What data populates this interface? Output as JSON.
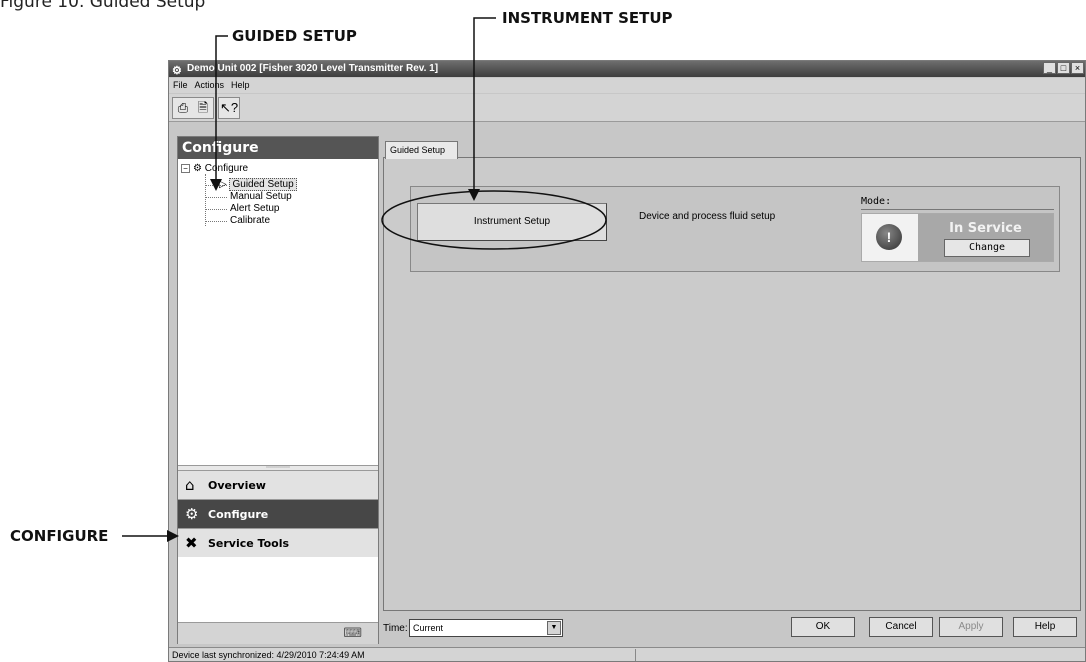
{
  "figure": {
    "title": "Figure 10. Guided Setup",
    "callouts": {
      "guided_setup": "GUIDED SETUP",
      "instrument_setup": "INSTRUMENT SETUP",
      "configure": "CONFIGURE"
    }
  },
  "window": {
    "title": "Demo Unit 002 [Fisher 3020 Level Transmitter Rev. 1]",
    "controls": [
      "_",
      "□",
      "×"
    ]
  },
  "menu": [
    "File",
    "Actions",
    "Help"
  ],
  "toolbar": {
    "icons": [
      "print-icon",
      "print-preview-icon",
      "help-pointer-icon"
    ]
  },
  "left_panel": {
    "header": "Configure",
    "tree": {
      "root": "Configure",
      "children": [
        "Guided Setup",
        "Manual Setup",
        "Alert Setup",
        "Calibrate"
      ],
      "selected": "Guided Setup"
    },
    "nav": [
      "Overview",
      "Configure",
      "Service Tools"
    ],
    "active_nav": "Configure"
  },
  "main": {
    "tab": "Guided Setup",
    "instrument_button": "Instrument Setup",
    "instrument_desc": "Device and process fluid setup",
    "mode": {
      "label": "Mode:",
      "status": "In Service",
      "change": "Change"
    }
  },
  "bottom": {
    "time_label": "Time:",
    "time_value": "Current",
    "buttons": {
      "ok": "OK",
      "cancel": "Cancel",
      "apply": "Apply",
      "help": "Help"
    }
  },
  "status": {
    "text": "Device last synchronized: 4/29/2010 7:24:49 AM"
  }
}
